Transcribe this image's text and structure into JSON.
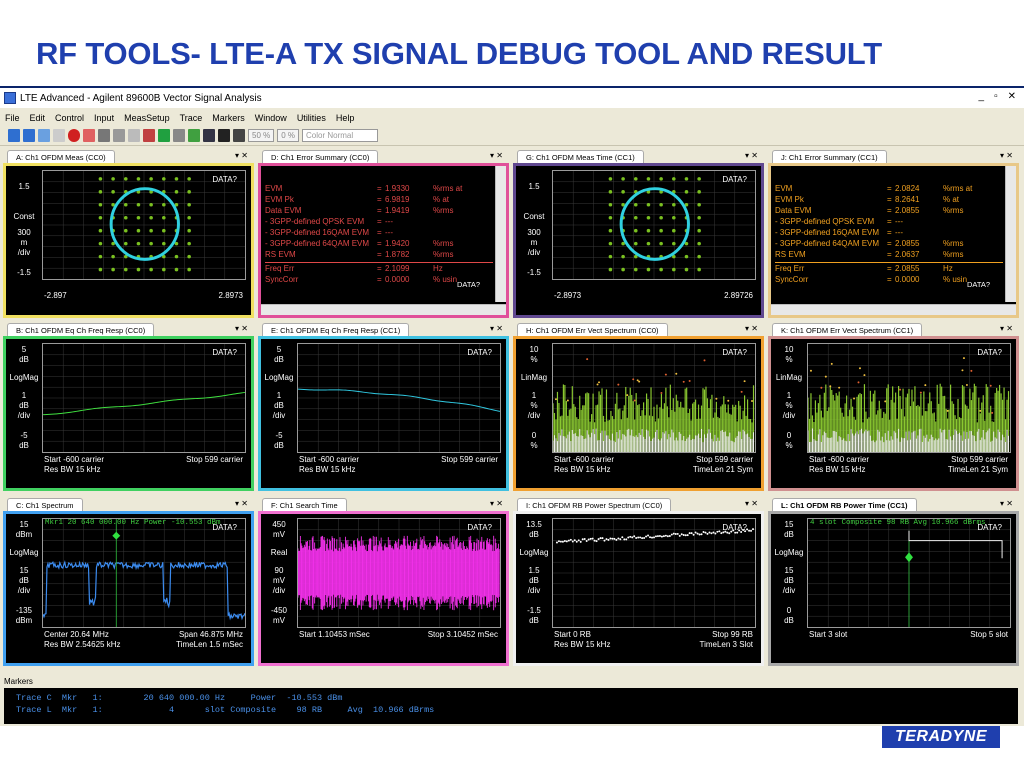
{
  "slide": {
    "title": "RF TOOLS- LTE-A TX SIGNAL DEBUG TOOL AND RESULT",
    "logo": "TERADYNE"
  },
  "window": {
    "title": "LTE Advanced - Agilent 89600B Vector Signal Analysis",
    "controls": [
      "_",
      "▫",
      "✕"
    ]
  },
  "menu": [
    "File",
    "Edit",
    "Control",
    "Input",
    "MeasSetup",
    "Trace",
    "Markers",
    "Window",
    "Utilities",
    "Help"
  ],
  "toolbar": {
    "zoom1": "50 %",
    "zoom2": "0 %",
    "color_select": "Color Normal"
  },
  "panes": {
    "a": {
      "tab": "A: Ch1 OFDM Meas (CC0)",
      "data": "DATA?",
      "y": [
        "1.5",
        "Const",
        "300",
        "m",
        "/div",
        "-1.5"
      ],
      "x_left": "-2.897",
      "x_right": "2.8973"
    },
    "d": {
      "tab": "D: Ch1 Error Summary (CC0)",
      "data": "DATA?",
      "rows": [
        {
          "k": "EVM",
          "v": "1.9330",
          "u": "%rms  at"
        },
        {
          "k": "EVM Pk",
          "v": "6.9819",
          "u": "%   at"
        },
        {
          "k": "Data EVM",
          "v": "1.9419",
          "u": "%rms"
        },
        {
          "k": " - 3GPP-defined QPSK EVM",
          "v": "---",
          "u": ""
        },
        {
          "k": " - 3GPP-defined 16QAM EVM",
          "v": "---",
          "u": ""
        },
        {
          "k": " - 3GPP-defined 64QAM EVM",
          "v": "1.9420",
          "u": "%rms"
        },
        {
          "k": "RS EVM",
          "v": "1.8782",
          "u": "%rms"
        },
        {
          "k": "Freq Err",
          "v": "2.1099",
          "u": "Hz"
        },
        {
          "k": "SyncCorr",
          "v": "0.0000",
          "u": "% usin"
        }
      ]
    },
    "g": {
      "tab": "G: Ch1 OFDM Meas Time (CC1)",
      "data": "DATA?",
      "y": [
        "1.5",
        "Const",
        "300",
        "m",
        "/div",
        "-1.5"
      ],
      "x_left": "-2.8973",
      "x_right": "2.89726"
    },
    "j": {
      "tab": "J: Ch1 Error Summary (CC1)",
      "data": "DATA?",
      "rows": [
        {
          "k": "EVM",
          "v": "2.0824",
          "u": "%rms  at"
        },
        {
          "k": "EVM Pk",
          "v": "8.2641",
          "u": "%   at"
        },
        {
          "k": "Data EVM",
          "v": "2.0855",
          "u": "%rms"
        },
        {
          "k": " - 3GPP-defined QPSK EVM",
          "v": "---",
          "u": ""
        },
        {
          "k": " - 3GPP-defined 16QAM EVM",
          "v": "---",
          "u": ""
        },
        {
          "k": " - 3GPP-defined 64QAM EVM",
          "v": "2.0855",
          "u": "%rms"
        },
        {
          "k": "RS EVM",
          "v": "2.0637",
          "u": "%rms"
        },
        {
          "k": "Freq Err",
          "v": "2.0855",
          "u": "Hz"
        },
        {
          "k": "SyncCorr",
          "v": "0.0000",
          "u": "% usin"
        }
      ]
    },
    "b": {
      "tab": "B: Ch1 OFDM Eq Ch Freq Resp (CC0)",
      "data": "DATA?",
      "y": [
        "5",
        "dB",
        "LogMag",
        "1",
        "dB",
        "/div",
        "-5",
        "dB"
      ],
      "x1": "Start -600  carrier",
      "x2": "Res BW 15 kHz",
      "x3": "Stop 599  carrier",
      "x4": ""
    },
    "e": {
      "tab": "E: Ch1 OFDM Eq Ch Freq Resp (CC1)",
      "data": "DATA?",
      "y": [
        "5",
        "dB",
        "LogMag",
        "1",
        "dB",
        "/div",
        "-5",
        "dB"
      ],
      "x1": "Start -600  carrier",
      "x2": "Res BW 15 kHz",
      "x3": "Stop 599  carrier",
      "x4": ""
    },
    "h": {
      "tab": "H: Ch1 OFDM Err Vect Spectrum (CC0)",
      "data": "DATA?",
      "y": [
        "10",
        "%",
        "LinMag",
        "1",
        "%",
        "/div",
        "0",
        "%"
      ],
      "x1": "Start -600  carrier",
      "x2": "Res BW 15 kHz",
      "x3": "Stop 599  carrier",
      "x4": "TimeLen 21  Sym"
    },
    "k": {
      "tab": "K: Ch1 OFDM Err Vect Spectrum (CC1)",
      "data": "DATA?",
      "y": [
        "10",
        "%",
        "LinMag",
        "1",
        "%",
        "/div",
        "0",
        "%"
      ],
      "x1": "Start -600  carrier",
      "x2": "Res BW 15 kHz",
      "x3": "Stop 599  carrier",
      "x4": "TimeLen 21  Sym"
    },
    "c": {
      "tab": "C: Ch1 Spectrum",
      "data": "DATA?",
      "marker": "Mkr1  20 640 000.00 Hz       Power  -10.553 dBm",
      "y": [
        "15",
        "dBm",
        "LogMag",
        "15",
        "dB",
        "/div",
        "-135",
        "dBm"
      ],
      "x1": "Center 20.64 MHz",
      "x2": "Res BW 2.54625 kHz",
      "x3": "Span 46.875 MHz",
      "x4": "TimeLen 1.5 mSec"
    },
    "f": {
      "tab": "F: Ch1 Search Time",
      "data": "DATA?",
      "y": [
        "450",
        "mV",
        "Real",
        "90",
        "mV",
        "/div",
        "-450",
        "mV"
      ],
      "x1": "Start 1.10453 mSec",
      "x2": "",
      "x3": "Stop 3.10452 mSec",
      "x4": ""
    },
    "i": {
      "tab": "I: Ch1 OFDM RB Power Spectrum (CC0)",
      "data": "DATA?",
      "y": [
        "13.5",
        "dB",
        "LogMag",
        "1.5",
        "dB",
        "/div",
        "-1.5",
        "dB"
      ],
      "x1": "Start 0  RB",
      "x2": "Res BW 15 kHz",
      "x3": "Stop 99  RB",
      "x4": "TimeLen 3  Slot"
    },
    "l": {
      "tab": "L: Ch1 OFDM RB Power Time (CC1)",
      "data": "DATA?",
      "marker": "4 slot Composite   98 RB    Avg  10.966 dBrms",
      "y": [
        "15",
        "dB",
        "LogMag",
        "15",
        "dB",
        "/div",
        "0",
        "dB"
      ],
      "x1": "Start 3  slot",
      "x2": "",
      "x3": "Stop 5  slot",
      "x4": ""
    }
  },
  "markers": {
    "title": "Markers",
    "rows": [
      "Trace C  Mkr   1:        20 640 000.00 Hz     Power  -10.553 dBm",
      "Trace L  Mkr   1:             4      slot Composite    98 RB     Avg  10.966 dBrms"
    ]
  },
  "colors": {
    "brand": "#1f3fae",
    "pane_a": "#f0e060",
    "pane_d": "#e0509a",
    "pane_g": "#604890",
    "pane_j": "#e8c888",
    "pane_b": "#40d060",
    "pane_e": "#40c0e0",
    "pane_h": "#f0a030",
    "pane_k": "#d09090",
    "pane_c": "#40a0f0",
    "pane_f": "#f070d0",
    "pane_i": "#f0f0f0",
    "pane_l": "#a8a8a8"
  }
}
